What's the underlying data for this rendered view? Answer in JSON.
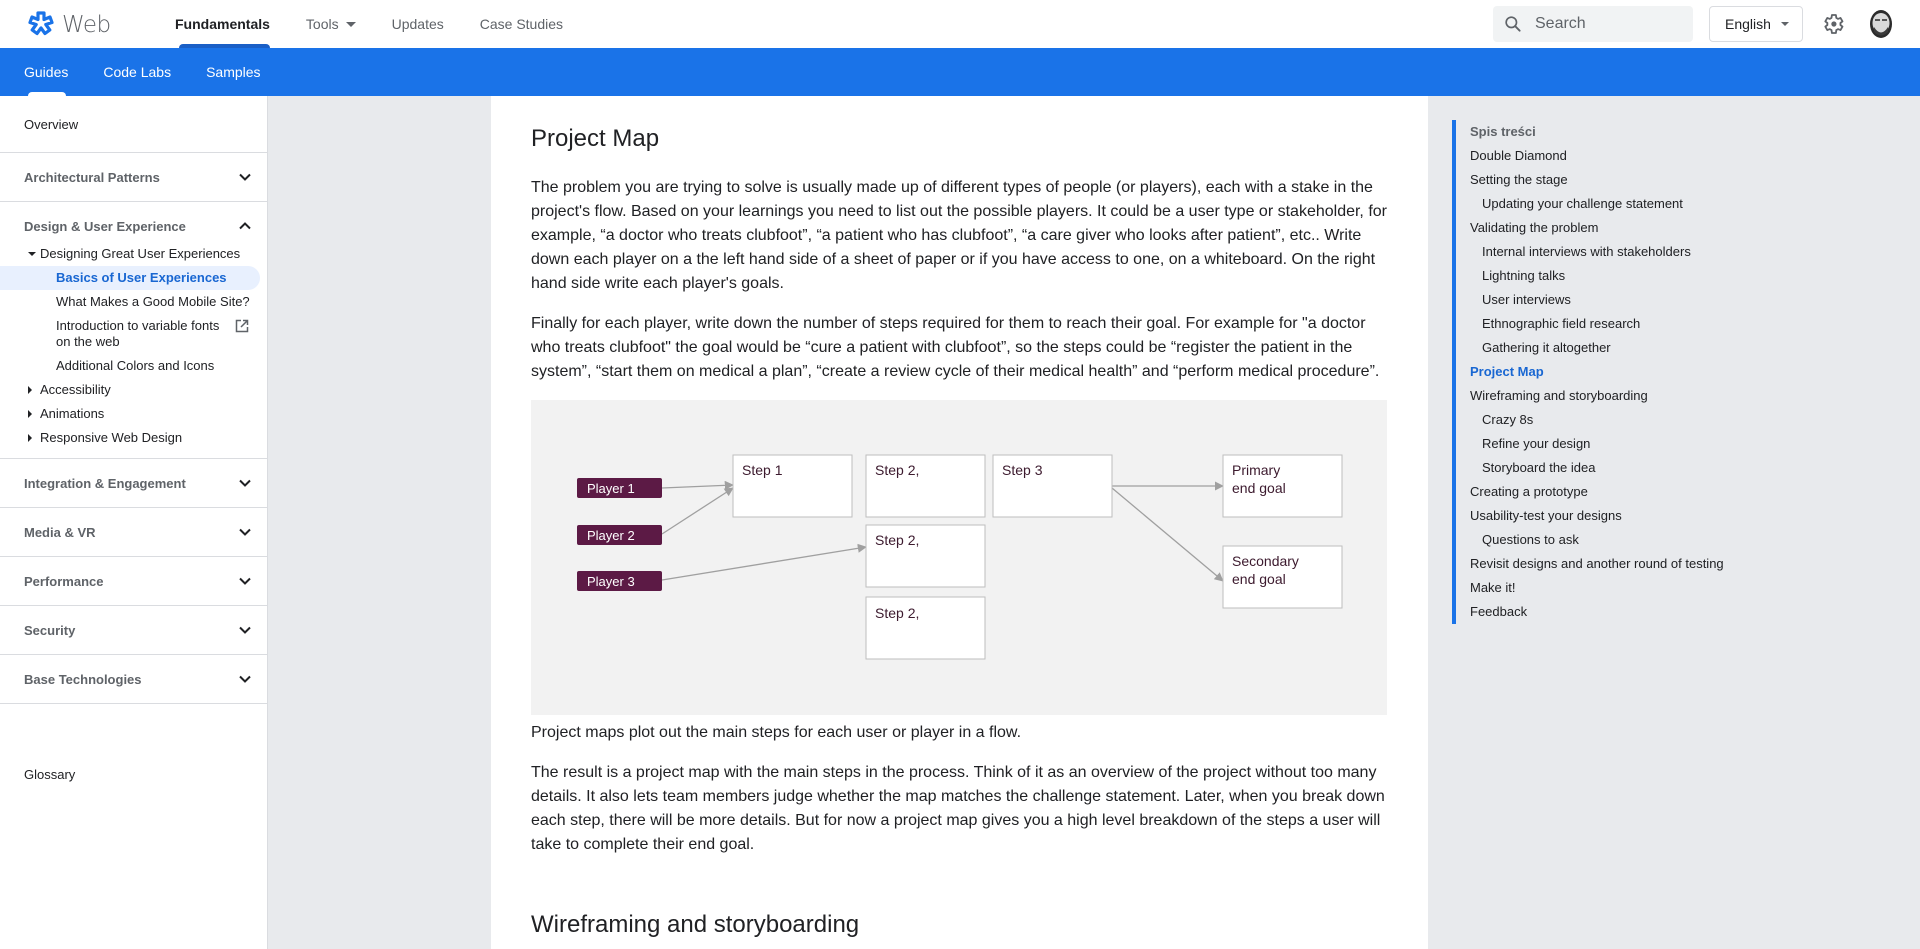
{
  "header": {
    "logo_text": "Web",
    "tabs": [
      {
        "label": "Fundamentals",
        "active": true
      },
      {
        "label": "Tools",
        "has_dropdown": true
      },
      {
        "label": "Updates"
      },
      {
        "label": "Case Studies"
      }
    ],
    "search_placeholder": "Search",
    "language": "English",
    "icons": {
      "logo": "asterisk-logo-icon",
      "search": "search-icon",
      "settings": "gear-icon",
      "account": "avatar"
    }
  },
  "subnav": {
    "tabs": [
      {
        "label": "Guides",
        "active": true
      },
      {
        "label": "Code Labs"
      },
      {
        "label": "Samples"
      }
    ]
  },
  "sidebar": {
    "overview": "Overview",
    "sections": [
      {
        "label": "Architectural Patterns",
        "expanded": false
      },
      {
        "label": "Design & User Experience",
        "expanded": true,
        "items": [
          {
            "label": "Designing Great User Experiences",
            "level": 1,
            "toggle": "expanded"
          },
          {
            "label": "Basics of User Experiences",
            "level": 2,
            "active": true
          },
          {
            "label": "What Makes a Good Mobile Site?",
            "level": 2
          },
          {
            "label": "Introduction to variable fonts on the web",
            "level": 2,
            "external": true
          },
          {
            "label": "Additional Colors and Icons",
            "level": 2
          },
          {
            "label": "Accessibility",
            "level": 1,
            "toggle": "collapsed"
          },
          {
            "label": "Animations",
            "level": 1,
            "toggle": "collapsed"
          },
          {
            "label": "Responsive Web Design",
            "level": 1,
            "toggle": "collapsed"
          }
        ]
      },
      {
        "label": "Integration & Engagement",
        "expanded": false
      },
      {
        "label": "Media & VR",
        "expanded": false
      },
      {
        "label": "Performance",
        "expanded": false
      },
      {
        "label": "Security",
        "expanded": false
      },
      {
        "label": "Base Technologies",
        "expanded": false
      }
    ],
    "glossary": "Glossary"
  },
  "main": {
    "heading": "Project Map",
    "paragraphs": [
      "The problem you are trying to solve is usually made up of different types of people (or players), each with a stake in the project's flow. Based on your learnings you need to list out the possible players. It could be a user type or stakeholder, for example, “a doctor who treats clubfoot”, “a patient who has clubfoot”, “a care giver who looks after patient”, etc.. Write down each player on a the left hand side of a sheet of paper or if you have access to one, on a whiteboard. On the right hand side write each player's goals.",
      "Finally for each player, write down the number of steps required for them to reach their goal. For example for \"a doctor who treats clubfoot\" the goal would be “cure a patient with clubfoot”, so the steps could be “register the patient in the system”, “start them on medical a plan”, “create a review cycle of their medical health” and “perform medical procedure”."
    ],
    "diagram": {
      "players": [
        "Player 1",
        "Player 2",
        "Player 3"
      ],
      "steps": {
        "step1": "Step 1",
        "step2_top": "Step 2,",
        "step2_mid": "Step 2,",
        "step2_bottom": "Step 2,",
        "step3": "Step 3"
      },
      "goals": {
        "primary": [
          "Primary",
          "end goal"
        ],
        "secondary": [
          "Secondary",
          "end goal"
        ]
      },
      "colors": {
        "player_fill": "#5c1a45",
        "box_border": "#bdbdbd",
        "arrow": "#a0a0a0",
        "background": "#f2f2f2",
        "box_text": "#3c1a2e"
      }
    },
    "caption": "Project maps plot out the main steps for each user or player in a flow.",
    "paragraph_after": "The result is a project map with the main steps in the process. Think of it as an overview of the project without too many details. It also lets team members judge whether the map matches the challenge statement. Later, when you break down each step, there will be more details. But for now a project map gives you a high level breakdown of the steps a user will take to complete their end goal.",
    "next_heading": "Wireframing and storyboarding"
  },
  "toc": {
    "title": "Spis treści",
    "items": [
      {
        "label": "Double Diamond",
        "level": 1
      },
      {
        "label": "Setting the stage",
        "level": 1
      },
      {
        "label": "Updating your challenge statement",
        "level": 2
      },
      {
        "label": "Validating the problem",
        "level": 1
      },
      {
        "label": "Internal interviews with stakeholders",
        "level": 2
      },
      {
        "label": "Lightning talks",
        "level": 2
      },
      {
        "label": "User interviews",
        "level": 2
      },
      {
        "label": "Ethnographic field research",
        "level": 2
      },
      {
        "label": "Gathering it altogether",
        "level": 2
      },
      {
        "label": "Project Map",
        "level": 1,
        "active": true
      },
      {
        "label": "Wireframing and storyboarding",
        "level": 1
      },
      {
        "label": "Crazy 8s",
        "level": 2
      },
      {
        "label": "Refine your design",
        "level": 2
      },
      {
        "label": "Storyboard the idea",
        "level": 2
      },
      {
        "label": "Creating a prototype",
        "level": 1
      },
      {
        "label": "Usability-test your designs",
        "level": 1
      },
      {
        "label": "Questions to ask",
        "level": 2
      },
      {
        "label": "Revisit designs and another round of testing",
        "level": 1
      },
      {
        "label": "Make it!",
        "level": 1
      },
      {
        "label": "Feedback",
        "level": 1
      }
    ]
  },
  "colors": {
    "brand_blue": "#1a73e8",
    "active_link": "#1967d2",
    "active_bg": "#e8f0fe",
    "page_bg": "#e8eaed"
  }
}
